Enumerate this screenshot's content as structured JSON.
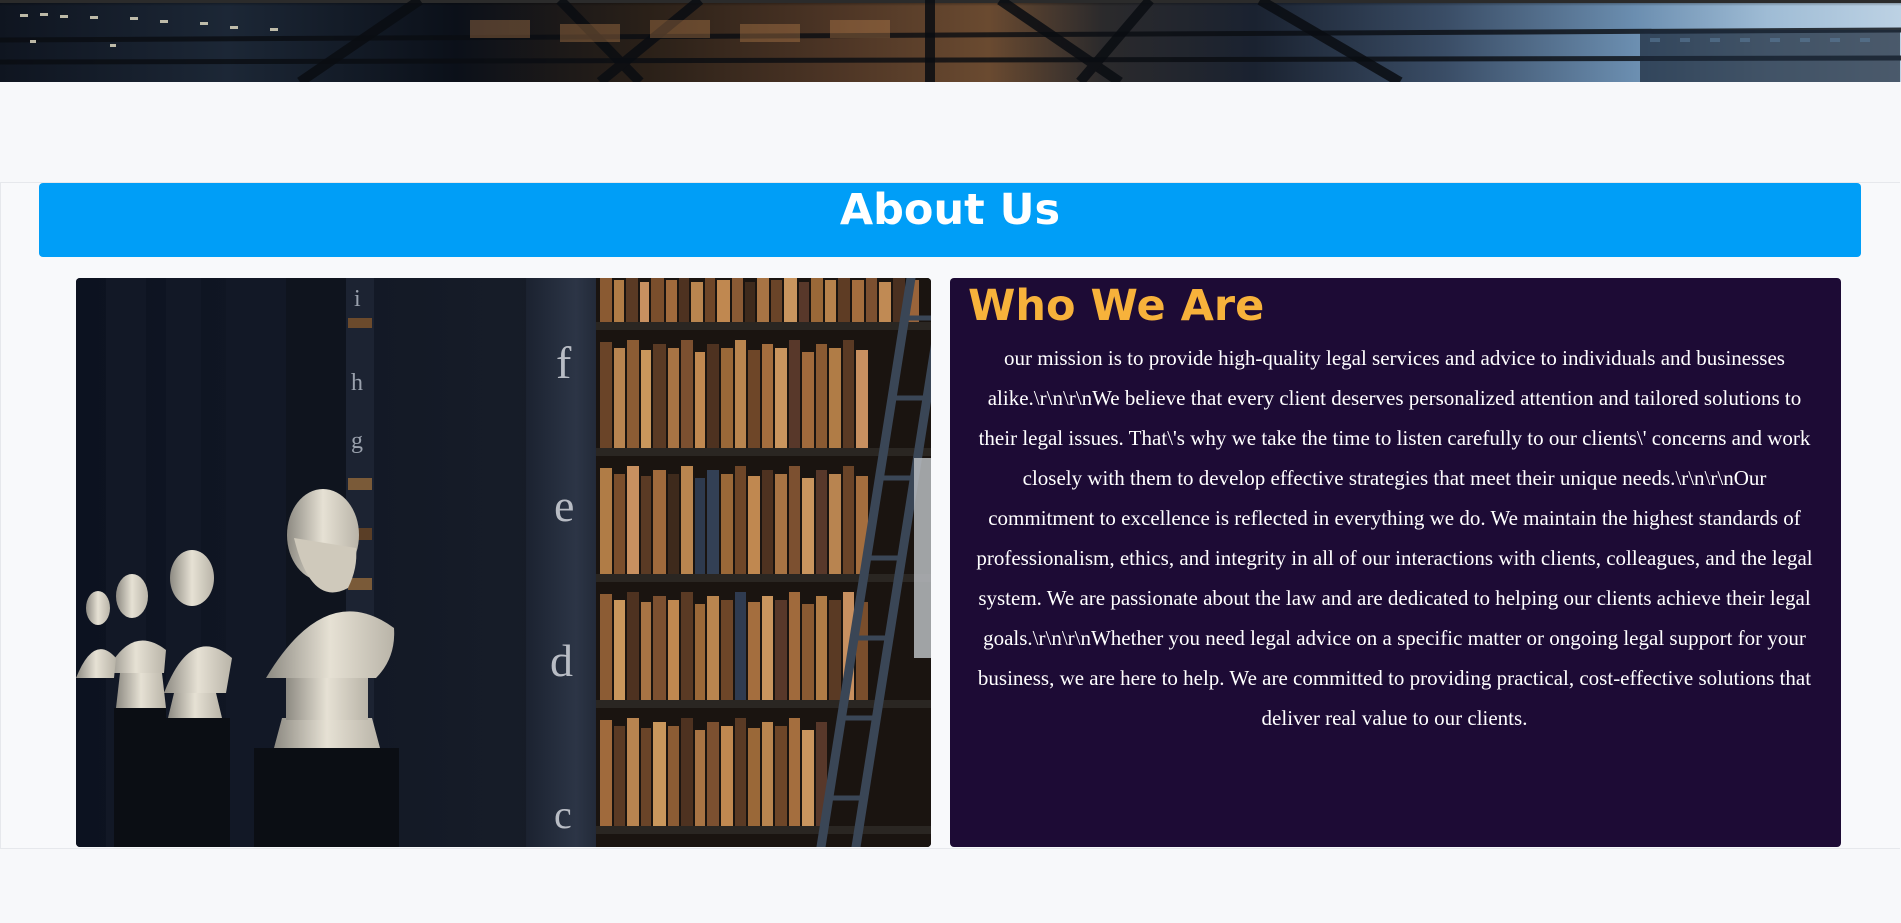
{
  "hero": {
    "image_description": "city-buildings-banner"
  },
  "about": {
    "title": "About Us",
    "bar_color": "#009ef7"
  },
  "image": {
    "alt": "library-busts-image"
  },
  "who_we_are": {
    "heading": "Who We Are",
    "heading_color": "#f7b23b",
    "background_color": "#1d0b35",
    "body": "our mission is to provide high-quality legal services and advice to individuals and businesses alike.\\r\\n\\r\\nWe believe that every client deserves personalized attention and tailored solutions to their legal issues. That\\'s why we take the time to listen carefully to our clients\\' concerns and work closely with them to develop effective strategies that meet their unique needs.\\r\\n\\r\\nOur commitment to excellence is reflected in everything we do. We maintain the highest standards of professionalism, ethics, and integrity in all of our interactions with clients, colleagues, and the legal system. We are passionate about the law and are dedicated to helping our clients achieve their legal goals.\\r\\n\\r\\nWhether you need legal advice on a specific matter or ongoing legal support for your business, we are here to help. We are committed to providing practical, cost-effective solutions that deliver real value to our clients."
  }
}
